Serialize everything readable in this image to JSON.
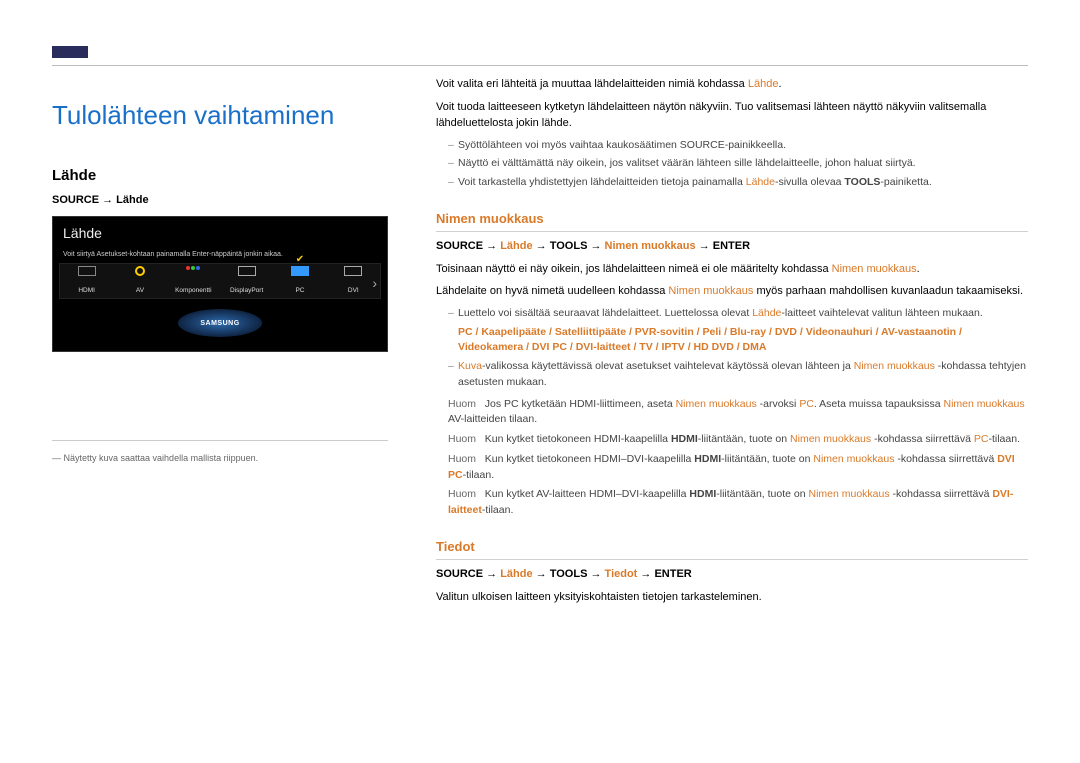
{
  "title": "Tulolähteen vaihtaminen",
  "left": {
    "h2": "Lähde",
    "path": "SOURCE → Lähde",
    "screenshot": {
      "title": "Lähde",
      "hint": "Voit siirtyä Asetukset-kohtaan painamalla Enter-näppäintä jonkin aikaa.",
      "items": [
        {
          "label": "HDMI"
        },
        {
          "label": "AV"
        },
        {
          "label": "Komponentti"
        },
        {
          "label": "DisplayPort"
        },
        {
          "label": "PC",
          "active": true
        },
        {
          "label": "DVI"
        }
      ],
      "logo": "SAMSUNG"
    },
    "caption": "― Näytetty kuva saattaa vaihdella mallista riippuen."
  },
  "right": {
    "intro1_a": "Voit valita eri lähteitä ja muuttaa lähdelaitteiden nimiä kohdassa ",
    "intro1_b": "Lähde",
    "intro1_c": ".",
    "intro2": "Voit tuoda laitteeseen kytketyn lähdelaitteen näytön näkyviin. Tuo valitsemasi lähteen näyttö näkyviin valitsemalla lähdeluettelosta jokin lähde.",
    "d1": "Syöttölähteen voi myös vaihtaa kaukosäätimen SOURCE-painikkeella.",
    "d2": "Näyttö ei välttämättä näy oikein, jos valitset väärän lähteen sille lähdelaitteelle, johon haluat siirtyä.",
    "d3_a": "Voit tarkastella yhdistettyjen lähdelaitteiden tietoja painamalla ",
    "d3_b": "Lähde",
    "d3_c": "-sivulla olevaa ",
    "d3_d": "TOOLS",
    "d3_e": "-painiketta.",
    "sec1": {
      "heading": "Nimen muokkaus",
      "path_a": "SOURCE → ",
      "path_b": "Lähde",
      "path_c": " → ",
      "path_d": "TOOLS",
      "path_e": " → ",
      "path_f": "Nimen muokkaus",
      "path_g": " → ",
      "path_h": "ENTER",
      "p1_a": "Toisinaan näyttö ei näy oikein, jos lähdelaitteen nimeä ei ole määritelty kohdassa ",
      "p1_b": "Nimen muokkaus",
      "p1_c": ".",
      "p2_a": "Lähdelaite on hyvä nimetä uudelleen kohdassa ",
      "p2_b": "Nimen muokkaus",
      "p2_c": " myös parhaan mahdollisen kuvanlaadun takaamiseksi.",
      "list_intro_a": "Luettelo voi sisältää seuraavat lähdelaitteet. Luettelossa olevat ",
      "list_intro_b": "Lähde",
      "list_intro_c": "-laitteet vaihtelevat valitun lähteen mukaan.",
      "devices": "PC / Kaapelipääte / Satelliittipääte / PVR-sovitin / Peli / Blu-ray / DVD / Videonauhuri / AV-vastaanotin / Videokamera / DVI PC / DVI-laitteet / TV / IPTV / HD DVD / DMA",
      "note_kuva_a": "Kuva",
      "note_kuva_b": "-valikossa käytettävissä olevat asetukset vaihtelevat käytössä olevan lähteen ja ",
      "note_kuva_c": "Nimen muokkaus",
      "note_kuva_d": " -kohdassa tehtyjen asetusten mukaan.",
      "h1_a": "Jos PC kytketään HDMI-liittimeen, aseta ",
      "h1_b": "Nimen muokkaus",
      "h1_c": " -arvoksi ",
      "h1_d": "PC",
      "h1_e": ". Aseta muissa tapauksissa ",
      "h1_f": "Nimen muokkaus",
      "h1_g": " AV-laitteiden tilaan.",
      "h2_a": "Kun kytket tietokoneen HDMI-kaapelilla ",
      "h2_b": "HDMI",
      "h2_c": "-liitäntään, tuote on ",
      "h2_d": "Nimen muokkaus",
      "h2_e": " -kohdassa siirrettävä ",
      "h2_f": "PC",
      "h2_g": "-tilaan.",
      "h3_a": "Kun kytket tietokoneen HDMI–DVI-kaapelilla ",
      "h3_b": "HDMI",
      "h3_c": "-liitäntään, tuote on ",
      "h3_d": "Nimen muokkaus",
      "h3_e": " -kohdassa siirrettävä ",
      "h3_f": "DVI PC",
      "h3_g": "-tilaan.",
      "h4_a": "Kun kytket AV-laitteen HDMI–DVI-kaapelilla ",
      "h4_b": "HDMI",
      "h4_c": "-liitäntään, tuote on ",
      "h4_d": "Nimen muokkaus",
      "h4_e": " -kohdassa siirrettävä ",
      "h4_f": "DVI-laitteet",
      "h4_g": "-tilaan."
    },
    "sec2": {
      "heading": "Tiedot",
      "path_a": "SOURCE → ",
      "path_b": "Lähde",
      "path_c": " → ",
      "path_d": "TOOLS",
      "path_e": " → ",
      "path_f": "Tiedot",
      "path_g": " → ",
      "path_h": "ENTER",
      "p": "Valitun ulkoisen laitteen yksityiskohtaisten tietojen tarkasteleminen."
    }
  }
}
